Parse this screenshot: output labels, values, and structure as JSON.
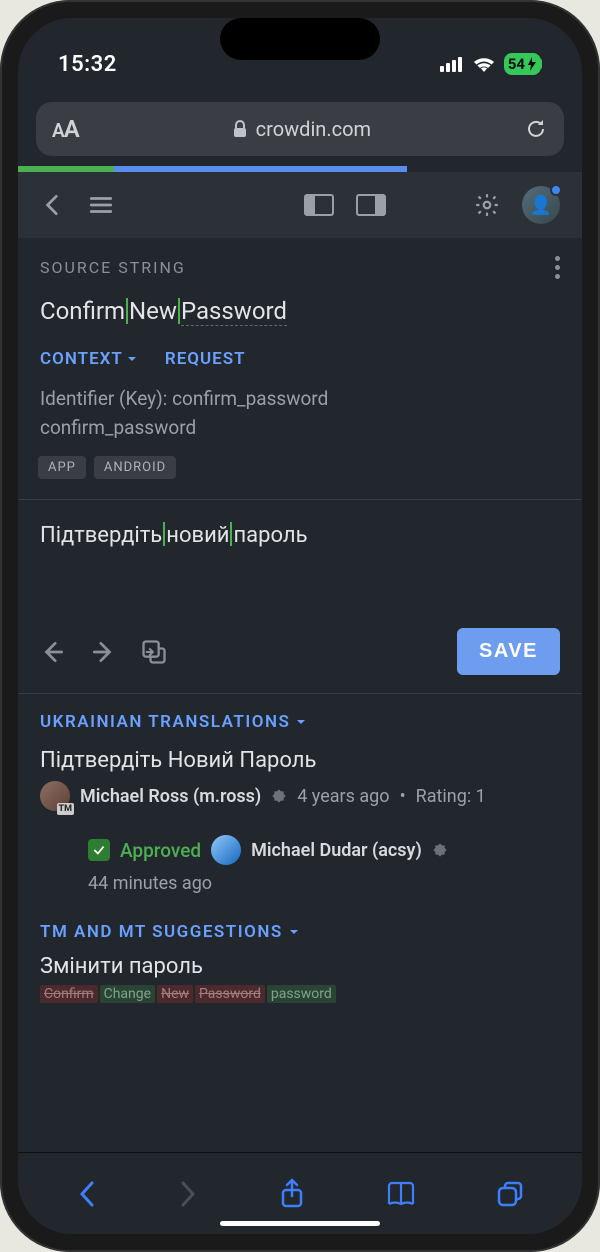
{
  "statusBar": {
    "time": "15:32",
    "battery": "54"
  },
  "urlBar": {
    "domain": "crowdin.com"
  },
  "header": {
    "sourceLabel": "SOURCE STRING"
  },
  "source": {
    "words": [
      "Confirm",
      "New",
      "Password"
    ],
    "contextLabel": "CONTEXT",
    "requestLabel": "REQUEST",
    "identifierLine": "Identifier (Key): confirm_password",
    "keyLine": "confirm_password",
    "tags": [
      "APP",
      "ANDROID"
    ]
  },
  "editor": {
    "words": [
      "Підтвердіть",
      "новий",
      "пароль"
    ],
    "saveLabel": "SAVE"
  },
  "translationsSection": {
    "title": "UKRAINIAN TRANSLATIONS",
    "entry": {
      "text": "Підтвердіть Новий Пароль",
      "author": "Michael Ross (m.ross)",
      "time": "4 years ago",
      "rating": "Rating: 1"
    },
    "approved": {
      "label": "Approved",
      "by": "Michael Dudar (acsy)",
      "time": "44 minutes ago"
    }
  },
  "tmSection": {
    "title": "TM AND MT SUGGESTIONS",
    "text": "Змінити пароль",
    "diff": [
      {
        "t": "Confirm",
        "c": "del"
      },
      {
        "t": "Change",
        "c": "add"
      },
      {
        "t": "New",
        "c": "keep del"
      },
      {
        "t": "Password",
        "c": "del"
      },
      {
        "t": "password",
        "c": "add"
      }
    ]
  }
}
